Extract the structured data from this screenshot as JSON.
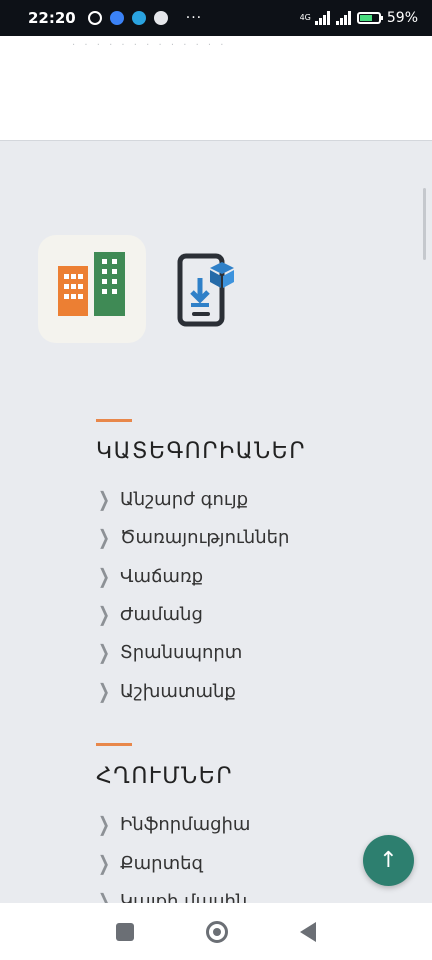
{
  "status_bar": {
    "time": "22:20",
    "network": "4G",
    "battery_percent": "59%"
  },
  "top_area": {
    "faint_text": "· · · · · · · · · · · · ·"
  },
  "sections": [
    {
      "title": "ԿԱՏԵԳՈՐԻԱՆԵՐ",
      "items": [
        "Անշարժ գույք",
        "Ծառայություններ",
        "Վաճառք",
        "Ժամանց",
        "Տրանսպորտ",
        "Աշխատանք"
      ]
    },
    {
      "title": "ՀՂՈՒՄՆԵՐ",
      "items": [
        "Ինֆորմացիա",
        "Քարտեզ",
        "Կայքի մասին"
      ]
    }
  ],
  "fab": {
    "icon": "arrow-up-icon",
    "label": "↑"
  },
  "colors": {
    "accent_orange": "#e8874a",
    "fab_green": "#2d7f6f",
    "building_orange": "#ec7f33",
    "building_green": "#3f8a55",
    "download_blue": "#2f80c8"
  }
}
